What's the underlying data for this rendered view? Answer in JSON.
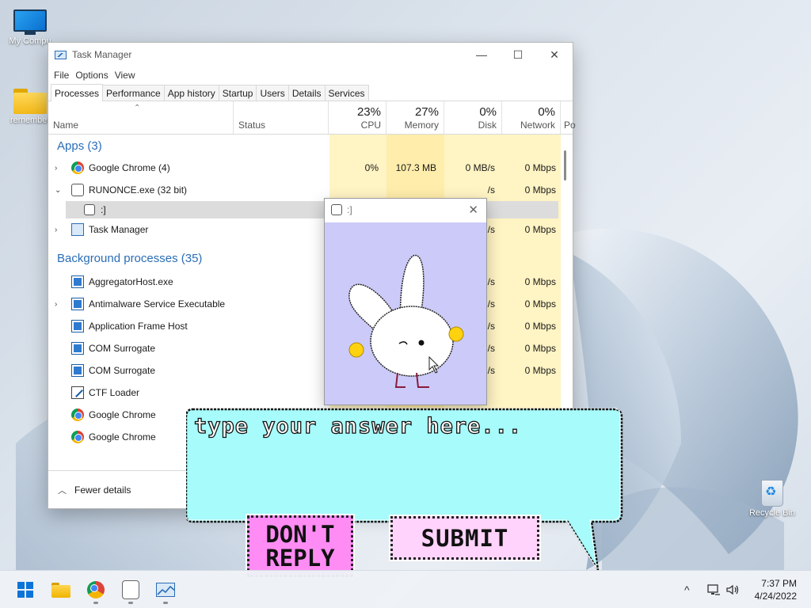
{
  "desktop": {
    "icons": [
      {
        "label": "My Compu",
        "icon": "monitor-icon"
      },
      {
        "label": "remember",
        "icon": "folder-icon"
      },
      {
        "label": "Recycle Bin",
        "icon": "recycle-bin-icon"
      }
    ]
  },
  "task_manager": {
    "title": "Task Manager",
    "window_controls": {
      "minimize": "—",
      "maximize": "☐",
      "close": "✕"
    },
    "menu": [
      "File",
      "Options",
      "View"
    ],
    "tabs": [
      "Processes",
      "Performance",
      "App history",
      "Startup",
      "Users",
      "Details",
      "Services"
    ],
    "active_tab": "Processes",
    "columns": {
      "name": "Name",
      "status": "Status",
      "cpu": {
        "percent": "23%",
        "label": "CPU"
      },
      "memory": {
        "percent": "27%",
        "label": "Memory"
      },
      "disk": {
        "percent": "0%",
        "label": "Disk"
      },
      "network": {
        "percent": "0%",
        "label": "Network"
      },
      "power": "Po"
    },
    "sort_glyph": "⌃",
    "groups": {
      "apps": "Apps (3)",
      "background": "Background processes (35)"
    },
    "rows": {
      "chrome_app": {
        "name": "Google Chrome (4)",
        "cpu": "0%",
        "memory": "107.3 MB",
        "disk": "0 MB/s",
        "network": "0 Mbps"
      },
      "runonce": {
        "name": "RUNONCE.exe (32 bit)",
        "disk": "/s",
        "network": "0 Mbps"
      },
      "runonce_child": {
        "name": ":]"
      },
      "taskmgr": {
        "name": "Task Manager",
        "disk": "/s",
        "network": "0 Mbps"
      },
      "aggregator": {
        "name": "AggregatorHost.exe",
        "disk": "/s",
        "network": "0 Mbps"
      },
      "antimalware": {
        "name": "Antimalware Service Executable",
        "disk": "/s",
        "network": "0 Mbps"
      },
      "appframe": {
        "name": "Application Frame Host",
        "disk": "/s",
        "network": "0 Mbps"
      },
      "com1": {
        "name": "COM Surrogate",
        "disk": "/s",
        "network": "0 Mbps"
      },
      "com2": {
        "name": "COM Surrogate",
        "disk": "/s",
        "network": "0 Mbps"
      },
      "ctf": {
        "name": "CTF Loader"
      },
      "chrome_bg1": {
        "name": "Google Chrome"
      },
      "chrome_bg2": {
        "name": "Google Chrome"
      }
    },
    "footer": {
      "label": "Fewer details"
    }
  },
  "popup": {
    "title": ":]",
    "close": "✕"
  },
  "dialog": {
    "placeholder": "type your answer here...",
    "dont_reply": "DON'T REPLY",
    "submit": "SUBMIT"
  },
  "taskbar": {
    "clock_time": "7:37 PM",
    "clock_date": "4/24/2022",
    "tray_chevron": "^",
    "tray_icons": [
      "network-icon",
      "volume-icon"
    ],
    "apps": [
      "start-button",
      "file-explorer",
      "chrome",
      "bunny-app",
      "task-manager"
    ]
  },
  "colors": {
    "accent_blue": "#2a6db7",
    "usage_yellow": "#fff4c4",
    "bubble_cyan": "#a7fbfb",
    "dont_reply_pink": "#ff8cf4",
    "submit_pink": "#ffd3fb",
    "popup_lavender": "#cccaf8"
  }
}
